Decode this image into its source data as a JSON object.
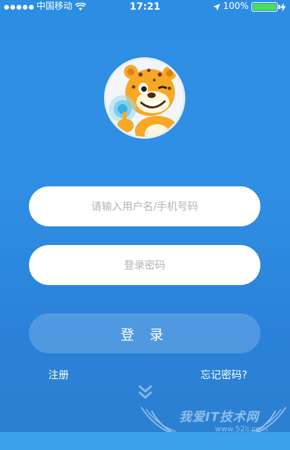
{
  "status_bar": {
    "carrier": "中国移动",
    "time": "17:21",
    "battery": "100%"
  },
  "form": {
    "username_placeholder": "请输入用户名/手机号码",
    "password_placeholder": "登录密码",
    "login_label": "登 录"
  },
  "links": {
    "register": "注册",
    "forgot_password": "忘记密码?"
  },
  "watermark": {
    "text": "我爱IT技术网",
    "sub": "www.52ij.com"
  },
  "colors": {
    "background": "#2c8ee3",
    "battery": "#4cd964"
  }
}
